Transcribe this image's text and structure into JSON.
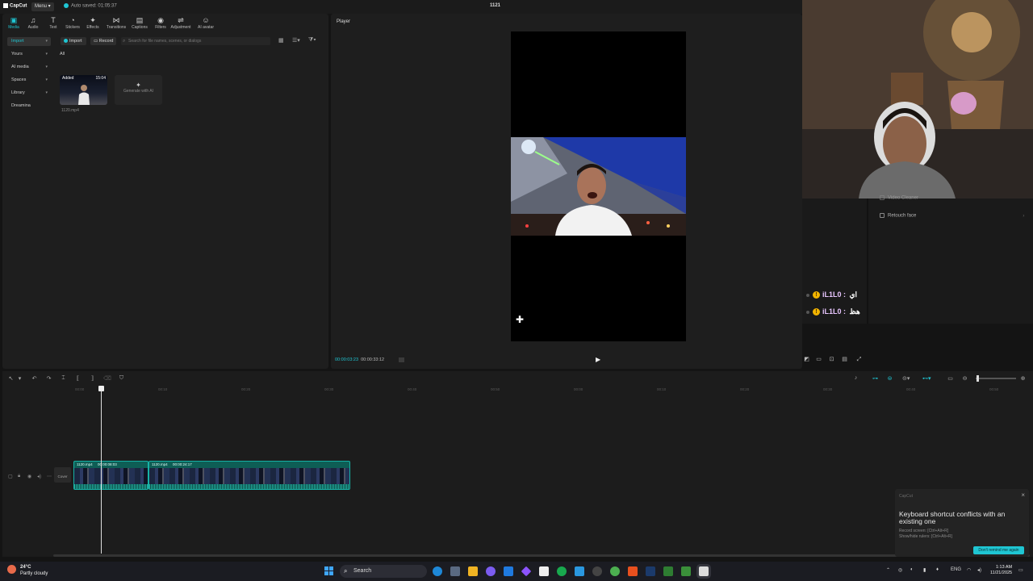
{
  "titlebar": {
    "app_name": "CapCut",
    "menu": "Menu",
    "autosave": "Auto saved: 01:05:37",
    "project": "1121"
  },
  "media": {
    "tools": [
      {
        "label": "Media",
        "icon": "▣"
      },
      {
        "label": "Audio",
        "icon": "♫"
      },
      {
        "label": "Text",
        "icon": "T"
      },
      {
        "label": "Stickers",
        "icon": "◔"
      },
      {
        "label": "Effects",
        "icon": "✦"
      },
      {
        "label": "Transitions",
        "icon": "⋈"
      },
      {
        "label": "Captions",
        "icon": "▤"
      },
      {
        "label": "Filters",
        "icon": "◉"
      },
      {
        "label": "Adjustment",
        "icon": "⇌"
      },
      {
        "label": "AI avatar",
        "icon": "☺"
      }
    ],
    "sidebar": [
      "Import",
      "Yours",
      "AI media",
      "Spaces",
      "Library",
      "Dreamina"
    ],
    "import_label": "Import",
    "record_label": "Record",
    "search_placeholder": "Search for file names, scenes, or dialogs",
    "filter_label": "All",
    "clip": {
      "tag": "Added",
      "duration": "15:04",
      "name": "1120.mp4"
    },
    "generate_label": "Generate with AI"
  },
  "player": {
    "title": "Player",
    "current_time": "00:00:03:23",
    "total_time": "00:00:33:12"
  },
  "right_panel": {
    "items": [
      "Video Cleaner",
      "Retouch face"
    ]
  },
  "chat": [
    {
      "user": "iL1L0",
      "message": "اي"
    },
    {
      "user": "iL1L0",
      "message": "هظ"
    }
  ],
  "timeline": {
    "ruler": [
      "00:00",
      "00:10",
      "00:20",
      "00:30",
      "00:40",
      "00:50",
      "00:00",
      "00:10",
      "00:20",
      "00:30",
      "00:40",
      "00:50"
    ],
    "cover_label": "Cover",
    "clips": [
      {
        "name": "1120.mp4",
        "duration": "00:00:08:03"
      },
      {
        "name": "1120.mp4",
        "duration": "00:00:24:17"
      }
    ]
  },
  "toast": {
    "app": "CapCut",
    "title": "Keyboard shortcut conflicts with an existing one",
    "line1": "Record screen: [Ctrl+Alt+R]",
    "line2": "Show/hide rulers: [Ctrl+Alt+R]",
    "dont_remind": "Don't remind me again"
  },
  "taskbar": {
    "temp": "24°C",
    "weather": "Partly cloudy",
    "search": "Search",
    "lang": "ENG",
    "time": "1:13 AM",
    "date": "11/21/2025"
  },
  "colors": {
    "accent": "#1fc6d3",
    "clip": "#0e5e55"
  }
}
